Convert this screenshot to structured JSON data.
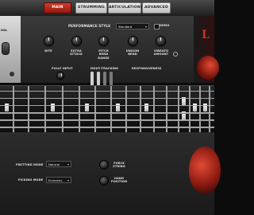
{
  "tabs": [
    {
      "label": "MAIN",
      "active": true
    },
    {
      "label": "STRUMMING",
      "active": false
    },
    {
      "label": "ARTICULATIONS",
      "active": false
    },
    {
      "label": "ADVANCED",
      "active": false
    }
  ],
  "left_panel": {
    "label": "NAL"
  },
  "performance": {
    "title": "PERFORMANCE STYLE",
    "style_value": "Standard",
    "demo_label": "DEMO"
  },
  "knobs": [
    {
      "label": "BITE"
    },
    {
      "label": "EXTRA ATTACK"
    },
    {
      "label": "PITCH BEND RANGE"
    },
    {
      "label": "UNISON BEND"
    },
    {
      "label": "VIBRATO AMOUNT"
    }
  ],
  "controls": {
    "fully_input_label": "FULLY INPUT",
    "latency_label": "LATENCY",
    "multitracking_label": "MULTI-TRACKING",
    "responsiveness_label": "RESPONSIVENESS"
  },
  "logo_text": "L",
  "bottom": {
    "fretting_mode_label": "FRETTING MODE",
    "fretting_mode_value": "Natural",
    "picking_mode_label": "PICKING MODE",
    "picking_mode_value": "Economy",
    "force_string_label": "FORCE STRING",
    "hand_position_label": "HAND POSITION"
  },
  "colors": {
    "accent": "#c8321f",
    "tab_inactive": "#d6d6d6",
    "panel": "#2b2b2b"
  }
}
